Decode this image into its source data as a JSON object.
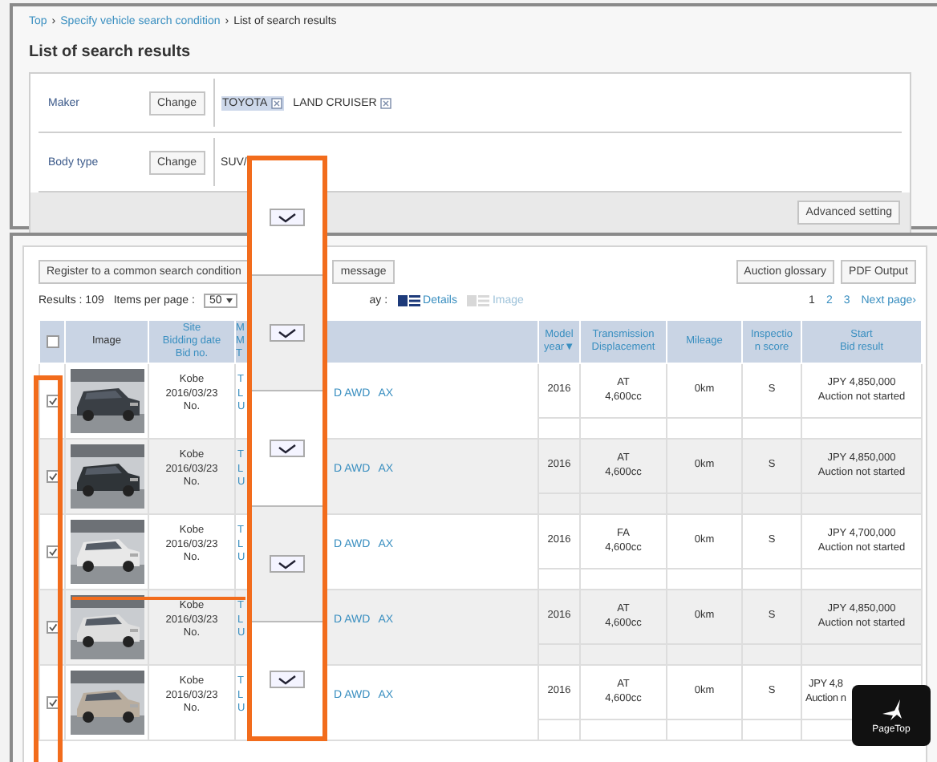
{
  "breadcrumb": [
    {
      "kind": "link",
      "text": "Top"
    },
    {
      "kind": "sep",
      "text": "›"
    },
    {
      "kind": "link",
      "text": "Specify vehicle search condition"
    },
    {
      "kind": "sep",
      "text": "›"
    },
    {
      "kind": "current",
      "text": "List of search results"
    }
  ],
  "title": "List of search results",
  "conditions": [
    {
      "label": "Maker",
      "button": "Change",
      "tags": [
        {
          "text": "TOYOTA",
          "selected": true
        },
        {
          "text": "LAND CRUISER",
          "selected": false
        }
      ]
    },
    {
      "label": "Body type",
      "button": "Change",
      "value": "SUV/"
    }
  ],
  "advanced_button": "Advanced setting",
  "toolbar": {
    "left_buttons": [
      "Register to a common search condition",
      "message"
    ],
    "right_buttons": [
      "Auction glossary",
      "PDF Output"
    ]
  },
  "results": {
    "count": "Results : 109",
    "per_page_label": "Items per page :",
    "per_page": "50",
    "display_label": "ay :",
    "views": [
      {
        "label": "Details",
        "selected": true
      },
      {
        "label": "Image",
        "selected": false
      }
    ],
    "pages": [
      {
        "label": "1",
        "selected": true
      },
      {
        "label": "2",
        "selected": false
      },
      {
        "label": "3",
        "selected": false
      }
    ],
    "next": "Next page›"
  },
  "table": {
    "header_checked": false,
    "columns": [
      [
        "Image"
      ],
      [
        "Site",
        "Bidding date",
        "Bid no."
      ],
      [
        "M",
        "M",
        "T"
      ],
      [
        "Model",
        "year▼"
      ],
      [
        "Transmission",
        "Displacement"
      ],
      [
        "Mileage"
      ],
      [
        "Inspectio",
        "n score"
      ],
      [
        "Start",
        "Bid result"
      ]
    ],
    "rows": [
      {
        "checked": true,
        "image": {
          "kind": "picture"
        },
        "site": [
          "Kobe",
          "2016/03/23",
          "No."
        ],
        "model": [
          "T",
          "L",
          "U"
        ],
        "links": [
          "D AWD",
          "AX"
        ],
        "year": "2016",
        "transmission": [
          "AT",
          "4,600cc"
        ],
        "mileage": "0km",
        "score": "S",
        "price": [
          "JPY 4,850,000",
          "Auction not started"
        ]
      },
      {
        "checked": true,
        "image": {
          "kind": "picture"
        },
        "site": [
          "Kobe",
          "2016/03/23",
          "No."
        ],
        "model": [
          "T",
          "L",
          "U"
        ],
        "links": [
          "D AWD",
          "AX"
        ],
        "year": "2016",
        "transmission": [
          "AT",
          "4,600cc"
        ],
        "mileage": "0km",
        "score": "S",
        "price": [
          "JPY 4,850,000",
          "Auction not started"
        ]
      },
      {
        "checked": true,
        "image": {
          "kind": "picture"
        },
        "site": [
          "Kobe",
          "2016/03/23",
          "No."
        ],
        "model": [
          "T",
          "L",
          "U"
        ],
        "links": [
          "D AWD",
          "AX"
        ],
        "year": "2016",
        "transmission": [
          "FA",
          "4,600cc"
        ],
        "mileage": "0km",
        "score": "S",
        "price": [
          "JPY 4,700,000",
          "Auction not started"
        ]
      },
      {
        "checked": true,
        "image": {
          "kind": "picture"
        },
        "site": [
          "Kobe",
          "2016/03/23",
          "No."
        ],
        "model": [
          "T",
          "L",
          "U"
        ],
        "links": [
          "D AWD",
          "AX"
        ],
        "year": "2016",
        "transmission": [
          "AT",
          "4,600cc"
        ],
        "mileage": "0km",
        "score": "S",
        "price": [
          "JPY 4,850,000",
          "Auction not started"
        ]
      },
      {
        "checked": true,
        "image": {
          "kind": "picture"
        },
        "site": [
          "Kobe",
          "2016/03/23",
          "No."
        ],
        "model": [
          "T",
          "L",
          "U"
        ],
        "links": [
          "D AWD",
          "AX"
        ],
        "year": "2016",
        "transmission": [
          "AT",
          "4,600cc"
        ],
        "mileage": "0km",
        "score": "S",
        "price": [
          "JPY 4,8",
          "Auction n"
        ],
        "price_cut": true
      }
    ]
  },
  "magnifier": {
    "cells": [
      {
        "checked": true
      },
      {
        "checked": true
      },
      {
        "checked": true
      },
      {
        "checked": true
      },
      {
        "checked": true
      }
    ]
  },
  "page_top": {
    "label": "PageTop"
  }
}
